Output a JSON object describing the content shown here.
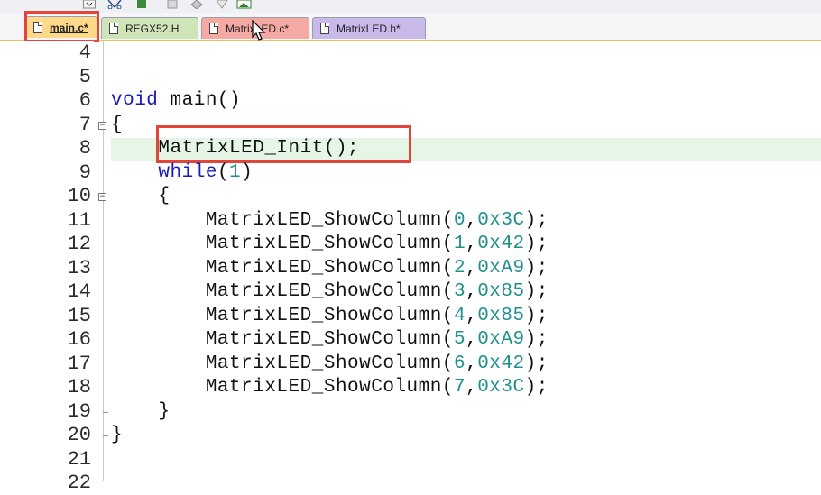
{
  "tabs": [
    {
      "label": "main.c*",
      "active": true
    },
    {
      "label": "REGX52.H",
      "active": false
    },
    {
      "label": "MatrixLED.c*",
      "active": false
    },
    {
      "label": "MatrixLED.h*",
      "active": false
    }
  ],
  "editor": {
    "lines": [
      {
        "n": "4",
        "code": ""
      },
      {
        "n": "5",
        "code": ""
      },
      {
        "n": "6",
        "code": "void main()"
      },
      {
        "n": "7",
        "code": "{"
      },
      {
        "n": "8",
        "code": "    MatrixLED_Init();"
      },
      {
        "n": "9",
        "code": "    while(1)"
      },
      {
        "n": "10",
        "code": "    {"
      },
      {
        "n": "11",
        "code": "        MatrixLED_ShowColumn(0,0x3C);"
      },
      {
        "n": "12",
        "code": "        MatrixLED_ShowColumn(1,0x42);"
      },
      {
        "n": "13",
        "code": "        MatrixLED_ShowColumn(2,0xA9);"
      },
      {
        "n": "14",
        "code": "        MatrixLED_ShowColumn(3,0x85);"
      },
      {
        "n": "15",
        "code": "        MatrixLED_ShowColumn(4,0x85);"
      },
      {
        "n": "16",
        "code": "        MatrixLED_ShowColumn(5,0xA9);"
      },
      {
        "n": "17",
        "code": "        MatrixLED_ShowColumn(6,0x42);"
      },
      {
        "n": "18",
        "code": "        MatrixLED_ShowColumn(7,0x3C);"
      },
      {
        "n": "19",
        "code": "    }"
      },
      {
        "n": "20",
        "code": "}"
      },
      {
        "n": "21",
        "code": ""
      },
      {
        "n": "22",
        "code": ""
      }
    ],
    "current_line": "8"
  },
  "colors": {
    "highlight_box": "#e2453c",
    "keyword": "#1b1bb8",
    "number": "#1f8f8f",
    "current_line_bg": "#e5f6e7"
  }
}
